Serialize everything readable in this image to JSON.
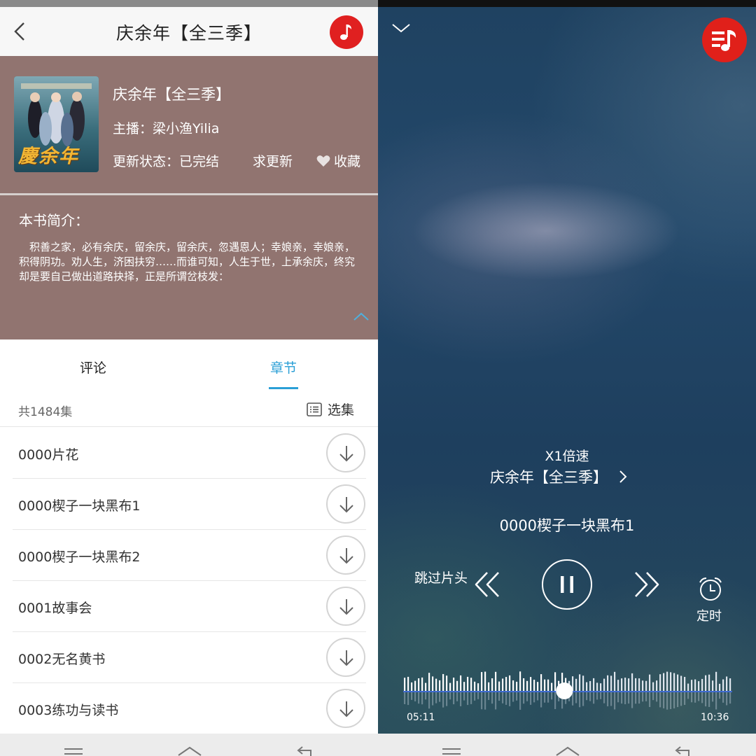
{
  "left": {
    "header": {
      "title": "庆余年【全三季】",
      "back_icon": "chevron-left-icon",
      "music_icon": "music-note-icon"
    },
    "book": {
      "title": "庆余年【全三季】",
      "host": "主播：梁小渔Yilia",
      "status": "更新状态：已完结",
      "urge_label": "求更新",
      "favorite_label": "收藏",
      "cover_text": "慶余年"
    },
    "intro": {
      "title": "本书简介：",
      "text": "积善之家，必有余庆，留余庆，留余庆，忽遇恩人；幸娘亲，幸娘亲，积得阴功。劝人生，济困扶穷……而谁可知，人生于世，上承余庆，终究却是要自己做出道路抉择，正是所谓岔枝发："
    },
    "tabs": {
      "comments": "评论",
      "chapters": "章节",
      "active": "章节"
    },
    "list": {
      "count": "共1484集",
      "select_label": "选集",
      "episodes": [
        {
          "title": "0000片花"
        },
        {
          "title": "0000楔子一块黑布1"
        },
        {
          "title": "0000楔子一块黑布2"
        },
        {
          "title": "0001故事会"
        },
        {
          "title": "0002无名黄书"
        },
        {
          "title": "0003练功与读书"
        }
      ]
    },
    "colors": {
      "accent": "#2a9fd6",
      "header_band": "#917470",
      "brand_red": "#e02020"
    }
  },
  "right": {
    "speed": "X1倍速",
    "album": "庆余年【全三季】",
    "track": "0000楔子一块黑布1",
    "skip_intro": "跳过片头",
    "timer_label": "定时",
    "time_current": "05:11",
    "time_total": "10:36",
    "progress": 0.49,
    "state": "playing"
  }
}
